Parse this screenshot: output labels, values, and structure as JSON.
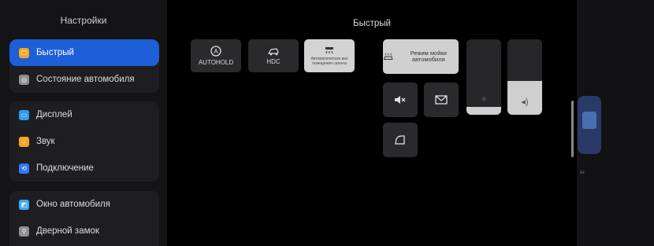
{
  "sidebar": {
    "title": "Настройки",
    "groups": [
      [
        {
          "label": "Быстрый",
          "icon": "quick-icon",
          "color": "#f5a623",
          "active": true
        },
        {
          "label": "Состояние автомобиля",
          "icon": "car-status-icon",
          "color": "#8e8e93",
          "active": false
        }
      ],
      [
        {
          "label": "Дисплей",
          "icon": "display-icon",
          "color": "#2f9cf0",
          "active": false
        },
        {
          "label": "Звук",
          "icon": "sound-icon",
          "color": "#f5a623",
          "active": false
        },
        {
          "label": "Подключение",
          "icon": "connection-icon",
          "color": "#3478f6",
          "active": false
        }
      ],
      [
        {
          "label": "Окно автомобиля",
          "icon": "window-icon",
          "color": "#3fa9f5",
          "active": false
        },
        {
          "label": "Дверной замок",
          "icon": "door-lock-icon",
          "color": "#8e8e93",
          "active": false
        }
      ]
    ]
  },
  "main": {
    "title": "Быстрый",
    "tiles": {
      "autohold": "AUTOHOLD",
      "hdc": "HDC",
      "ambient": "Автоматическое вкл освещения салона",
      "car_wash": "Режим мойки автомобиля"
    },
    "sliders": {
      "brightness_level": 0.1,
      "volume_level": 0.45
    }
  },
  "right_panel": {
    "text": "ы"
  },
  "colors": {
    "accent": "#1d5fd6",
    "sidebar_bg": "#141416",
    "main_bg": "#000000"
  }
}
